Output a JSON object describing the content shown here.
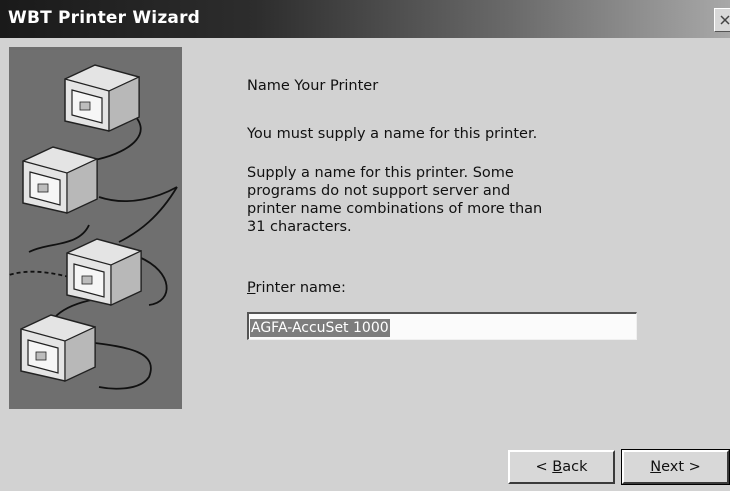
{
  "window": {
    "title": "WBT Printer Wizard"
  },
  "titlebar_icons": {
    "close": "close-icon"
  },
  "panel": {
    "illustration": "networked-computers-illustration"
  },
  "page": {
    "heading": "Name Your Printer",
    "subheading": "You must supply a name for this printer.",
    "description": "Supply a name for this printer. Some programs do not support server and printer name combinations of more than 31 characters."
  },
  "printer_name": {
    "label_mnemonic": "P",
    "label_rest": "rinter name:",
    "value": "AGFA-AccuSet 1000"
  },
  "buttons": {
    "back_prefix": "< ",
    "back_mnemonic": "B",
    "back_rest": "ack",
    "next_mnemonic": "N",
    "next_rest": "ext >"
  },
  "colors": {
    "panel": "#6f6f6f",
    "selection": "#7d7d7d",
    "window": "#d2d2d2"
  }
}
